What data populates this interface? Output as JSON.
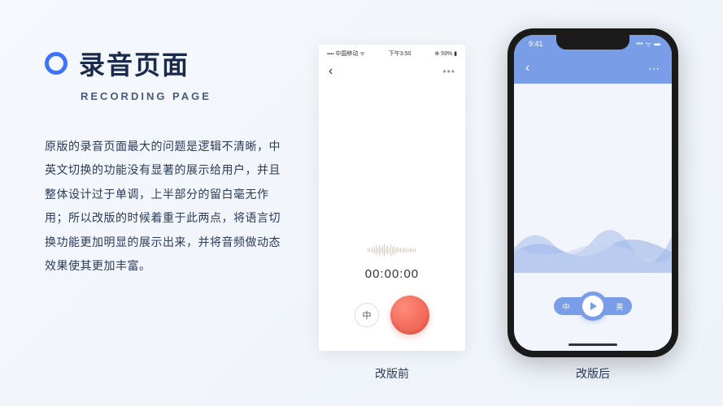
{
  "title": {
    "cn": "录音页面",
    "en": "RECORDING PAGE"
  },
  "description": "原版的录音页面最大的问题是逻辑不清晰，中英文切换的功能没有显著的展示给用户，并且整体设计过于单调，上半部分的留白毫无作用；所以改版的时候着重于此两点，将语言切换功能更加明显的展示出来，并将音频做动态效果使其更加丰富。",
  "old_phone": {
    "carrier": "中国移动",
    "time": "下午3:50",
    "battery": "59%",
    "timer": "00:00:00",
    "lang_btn": "中",
    "caption": "改版前"
  },
  "new_phone": {
    "time": "9:41",
    "lang_left": "中",
    "lang_right": "英",
    "caption": "改版后"
  }
}
